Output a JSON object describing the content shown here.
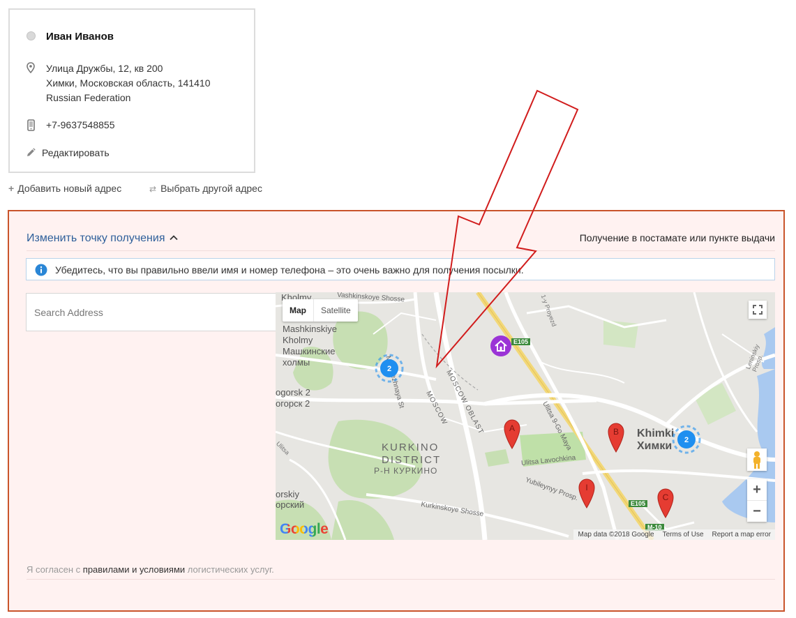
{
  "address_card": {
    "name": "Иван Иванов",
    "street": "Улица Дружбы, 12, кв 200",
    "city_line": "Химки, Московская область, 141410",
    "country": "Russian Federation",
    "phone": "+7-9637548855",
    "edit_label": "Редактировать",
    "icons": [
      "radio-icon",
      "pin-icon",
      "phone-icon",
      "pencil-icon"
    ]
  },
  "address_actions": {
    "add_label": "Добавить новый адрес",
    "choose_label": "Выбрать другой адрес"
  },
  "pickup": {
    "change_label": "Изменить точку получения",
    "mode_label": "Получение в постамате или пункте выдачи",
    "notice": "Убедитесь, что вы правильно ввели имя и номер телефона – это очень важно для получения посылки.",
    "search_placeholder": "Search Address"
  },
  "map": {
    "type_map": "Map",
    "type_satellite": "Satellite",
    "zoom_in": "+",
    "zoom_out": "−",
    "logo": "Google",
    "attribution": "Map data ©2018 Google",
    "terms": "Terms of Use",
    "report": "Report a map error",
    "labels": {
      "kholmy_en": "Kholmy",
      "mashkinskiye_en": "Mashkinskiye",
      "kholmy2_en": "Kholmy",
      "mashkinskiye_ru": "Машкинские",
      "kholmy_ru": "холмы",
      "gorsk_en": "ogorsk 2",
      "gorsk_ru": "огорск 2",
      "kurkino_en": "KURKINO",
      "district_en": "DISTRICT",
      "kurkino_ru": "Р-Н КУРКИНО",
      "khimki_en": "Khimki",
      "khimki_ru": "Химки",
      "orskiy_en": "orskiy",
      "orskiy_ru": "орский",
      "moscow_oblast": "MOSCOW OBLAST",
      "moscow": "MOSCOW",
      "molodezhnaya": "Molodezhnaya St",
      "vashkinskoye": "Vashkinskoye Shosse",
      "ulitsa_9": "Ulitsa 9-Go Maya",
      "lavochkina": "Ulitsa Lavochkina",
      "yubileyny": "Yubileynyy Prosp.",
      "kurkinskoye": "Kurkinskoye Shosse",
      "e105_a": "E105",
      "e105_b": "E105",
      "m10": "M-10",
      "leninskiy": "Leninskiy Prosp.",
      "proyezd": "1-y Proyezd",
      "ulitsa": "Ulitsa"
    },
    "markers": [
      "A",
      "B",
      "C",
      "I"
    ],
    "clusters": [
      "2",
      "2"
    ],
    "colors": {
      "marker": "#e53c32",
      "cluster": "#1f8ff0",
      "home": "#9b34d6"
    }
  },
  "terms": {
    "prefix": "Я согласен с ",
    "link": "правилами и условиями",
    "suffix": " логистических услуг."
  },
  "colors": {
    "accent_link": "#2e5f9a",
    "panel_border": "#c9542b",
    "panel_bg": "#fff2f1",
    "annotation_arrow": "#d11c1c"
  }
}
